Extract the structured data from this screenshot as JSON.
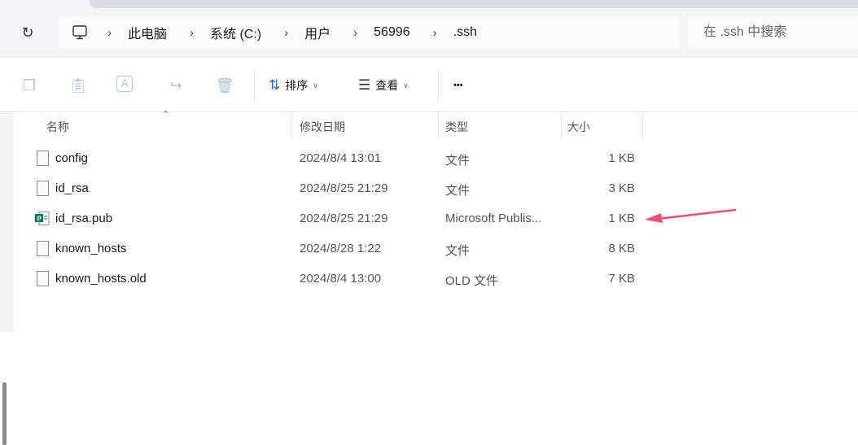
{
  "address": {
    "crumbs": [
      "此电脑",
      "系统 (C:)",
      "用户",
      "56996",
      ".ssh"
    ]
  },
  "search": {
    "placeholder": "在 .ssh 中搜索"
  },
  "toolbar": {
    "sort": "排序",
    "view": "查看",
    "more": "•••"
  },
  "columns": {
    "name": "名称",
    "date": "修改日期",
    "type": "类型",
    "size": "大小"
  },
  "files": [
    {
      "name": "config",
      "date": "2024/8/4 13:01",
      "type": "文件",
      "size": "1 KB",
      "icon": "file"
    },
    {
      "name": "id_rsa",
      "date": "2024/8/25 21:29",
      "type": "文件",
      "size": "3 KB",
      "icon": "file"
    },
    {
      "name": "id_rsa.pub",
      "date": "2024/8/25 21:29",
      "type": "Microsoft Publis...",
      "size": "1 KB",
      "icon": "publisher"
    },
    {
      "name": "known_hosts",
      "date": "2024/8/28 1:22",
      "type": "文件",
      "size": "8 KB",
      "icon": "file"
    },
    {
      "name": "known_hosts.old",
      "date": "2024/8/4 13:00",
      "type": "OLD 文件",
      "size": "7 KB",
      "icon": "file"
    }
  ],
  "colors": {
    "annotation_arrow": "#f0506e",
    "publisher": "#077568"
  }
}
